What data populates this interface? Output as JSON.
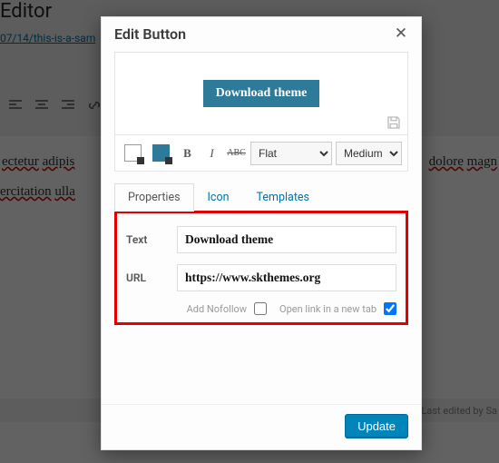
{
  "bg": {
    "page_title": "Editor",
    "permalink_fragment": "07/14/this-is-a-sam",
    "lorem_line1_words": [
      "ectetur",
      "adipis"
    ],
    "lorem_line1_tail_words": [
      "dolore",
      "magn"
    ],
    "lorem_line2_words": [
      "ercitation",
      "ulla"
    ],
    "footer_text": "am. Last edited by Sa"
  },
  "modal": {
    "title": "Edit Button",
    "preview_label": "Download theme",
    "style_select": "Flat",
    "size_select": "Medium",
    "tabs": {
      "properties": "Properties",
      "icon": "Icon",
      "templates": "Templates"
    },
    "fields": {
      "text_label": "Text",
      "text_value": "Download theme",
      "url_label": "URL",
      "url_value": "https://www.skthemes.org"
    },
    "checks": {
      "nofollow_label": "Add Nofollow",
      "nofollow_checked": false,
      "newtab_label": "Open link in a new tab",
      "newtab_checked": true
    },
    "update_label": "Update"
  },
  "colors": {
    "preview_button_bg": "#2e7a99",
    "primary_button_bg": "#0085ba",
    "highlight_border": "#e30000"
  }
}
